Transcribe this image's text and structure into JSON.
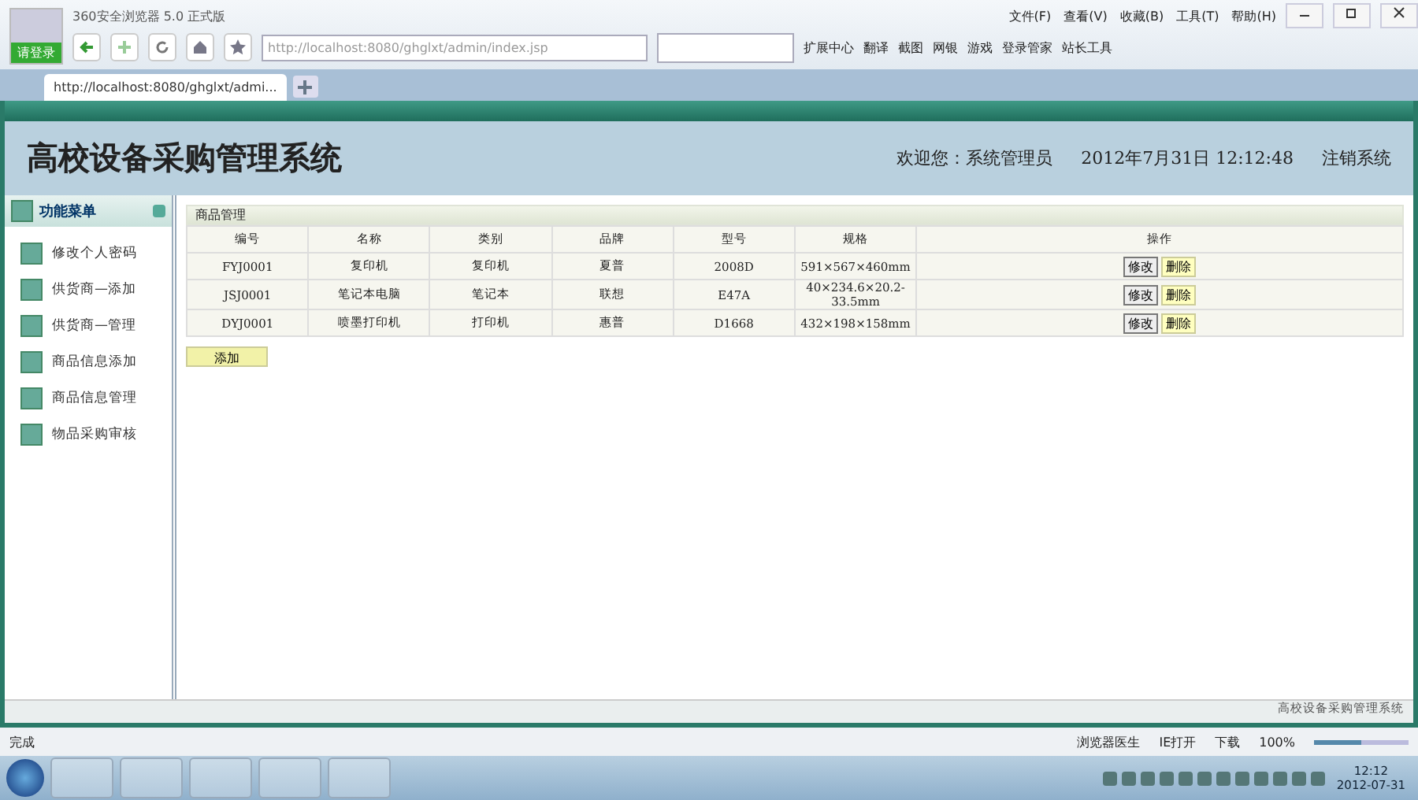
{
  "browser": {
    "title": "360安全浏览器 5.0 正式版",
    "login": "请登录",
    "address": "http://localhost:8080/ghglxt/admin/index.jsp",
    "menu": [
      "文件(F)",
      "查看(V)",
      "收藏(B)",
      "工具(T)",
      "帮助(H)"
    ],
    "toolbar": [
      "扩展中心",
      "翻译",
      "截图",
      "网银",
      "游戏",
      "登录管家",
      "站长工具"
    ],
    "tabs": [
      {
        "label": "http://localhost:8080/ghglxt/admi...",
        "selected": true
      }
    ]
  },
  "header": {
    "title": "高校设备采购管理系统",
    "welcome": "欢迎您：系统管理员",
    "datetime": "2012年7月31日  12:12:48",
    "logout": "注销系统"
  },
  "sidebar": {
    "title": "功能菜单",
    "items": [
      "修改个人密码",
      "供货商—添加",
      "供货商—管理",
      "商品信息添加",
      "商品信息管理",
      "物品采购审核"
    ]
  },
  "panel": {
    "title": "商品管理",
    "columns": [
      "编号",
      "名称",
      "类别",
      "品牌",
      "型号",
      "规格",
      "操作"
    ],
    "rows": [
      {
        "cells": [
          "FYJ0001",
          "复印机",
          "复印机",
          "夏普",
          "2008D",
          "591×567×460mm"
        ],
        "actions": [
          "修改",
          "删除"
        ]
      },
      {
        "cells": [
          "JSJ0001",
          "笔记本电脑",
          "笔记本",
          "联想",
          "E47A",
          "40×234.6×20.2-33.5mm"
        ],
        "actions": [
          "修改",
          "删除"
        ]
      },
      {
        "cells": [
          "DYJ0001",
          "喷墨打印机",
          "打印机",
          "惠普",
          "D1668",
          "432×198×158mm"
        ],
        "actions": [
          "修改",
          "删除"
        ]
      }
    ],
    "add_button": "添加"
  },
  "footer": "高校设备采购管理系统",
  "status_bar": {
    "status": "完成",
    "items": [
      "浏览器医生",
      "IE打开",
      "下载"
    ],
    "zoom": "100%",
    "zoom_slider": {
      "level": 0.5
    }
  },
  "taskbar": {
    "time": "12:12",
    "date": "2012-07-31"
  }
}
